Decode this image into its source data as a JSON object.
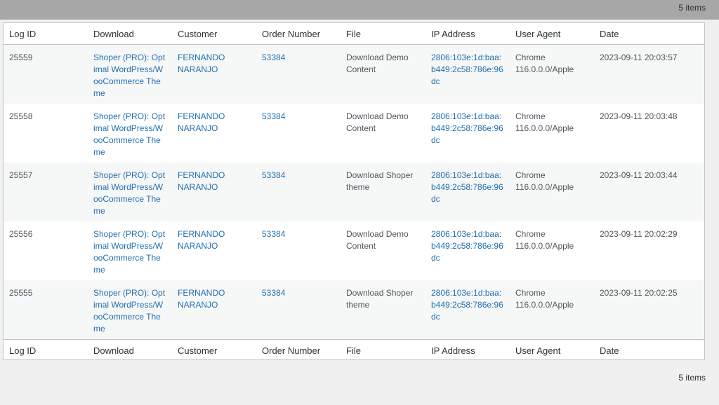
{
  "pagination": {
    "top_count": "5 items",
    "bottom_count": "5 items"
  },
  "columns": [
    "Log ID",
    "Download",
    "Customer",
    "Order Number",
    "File",
    "IP Address",
    "User Agent",
    "Date"
  ],
  "rows": [
    {
      "log_id": "25559",
      "download": "Shoper (PRO): Optimal WordPress/WooCommerce Theme",
      "customer": "FERNANDO NARANJO",
      "order": "53384",
      "file": "Download Demo Content",
      "ip": "2806:103e:1d:baa:b449:2c58:786e:96dc",
      "agent": "Chrome 116.0.0.0/Apple",
      "date": "2023-09-11 20:03:57"
    },
    {
      "log_id": "25558",
      "download": "Shoper (PRO): Optimal WordPress/WooCommerce Theme",
      "customer": "FERNANDO NARANJO",
      "order": "53384",
      "file": "Download Demo Content",
      "ip": "2806:103e:1d:baa:b449:2c58:786e:96dc",
      "agent": "Chrome 116.0.0.0/Apple",
      "date": "2023-09-11 20:03:48"
    },
    {
      "log_id": "25557",
      "download": "Shoper (PRO): Optimal WordPress/WooCommerce Theme",
      "customer": "FERNANDO NARANJO",
      "order": "53384",
      "file": "Download Shoper theme",
      "ip": "2806:103e:1d:baa:b449:2c58:786e:96dc",
      "agent": "Chrome 116.0.0.0/Apple",
      "date": "2023-09-11 20:03:44"
    },
    {
      "log_id": "25556",
      "download": "Shoper (PRO): Optimal WordPress/WooCommerce Theme",
      "customer": "FERNANDO NARANJO",
      "order": "53384",
      "file": "Download Demo Content",
      "ip": "2806:103e:1d:baa:b449:2c58:786e:96dc",
      "agent": "Chrome 116.0.0.0/Apple",
      "date": "2023-09-11 20:02:29"
    },
    {
      "log_id": "25555",
      "download": "Shoper (PRO): Optimal WordPress/WooCommerce Theme",
      "customer": "FERNANDO NARANJO",
      "order": "53384",
      "file": "Download Shoper theme",
      "ip": "2806:103e:1d:baa:b449:2c58:786e:96dc",
      "agent": "Chrome 116.0.0.0/Apple",
      "date": "2023-09-11 20:02:25"
    }
  ]
}
